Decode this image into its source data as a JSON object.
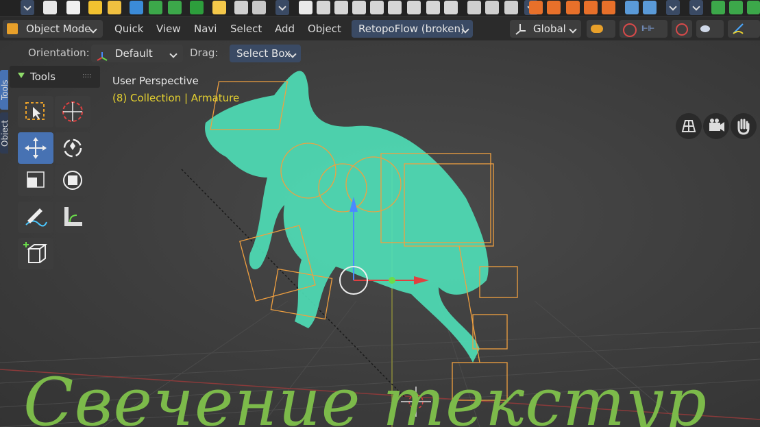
{
  "header": {
    "mode_label": "Object Mode",
    "menus": [
      "Quick",
      "View",
      "Navi",
      "Select",
      "Add",
      "Object"
    ],
    "addon_menu": "RetopoFlow (broken)",
    "transform_orientation": "Global"
  },
  "subheader": {
    "orientation_label": "Orientation:",
    "orientation_value": "Default",
    "drag_label": "Drag:",
    "drag_value": "Select Box"
  },
  "tools": {
    "title": "Tools",
    "side_tabs": [
      "Tools",
      "Object"
    ]
  },
  "viewport": {
    "view_name": "User Perspective",
    "collection_info": "(8) Collection | Armature"
  },
  "overlay": {
    "caption": "Свечение текстур"
  },
  "colors": {
    "accent": "#4772b3",
    "caption_green": "#7cba4a",
    "info_yellow": "#e6d230",
    "mesh_teal": "#4fe0b8",
    "bone_orange": "#f0a040"
  },
  "icons": [
    "chevron-down-icon",
    "new-file-icon",
    "open-folder-icon",
    "save-icon",
    "object-mode-icon",
    "move-icon",
    "rotate-icon",
    "scale-icon",
    "transform-icon",
    "cursor-icon",
    "select-box-icon",
    "annotate-icon",
    "measure-icon",
    "add-cube-icon",
    "grid-icon",
    "camera-icon",
    "hand-icon"
  ]
}
